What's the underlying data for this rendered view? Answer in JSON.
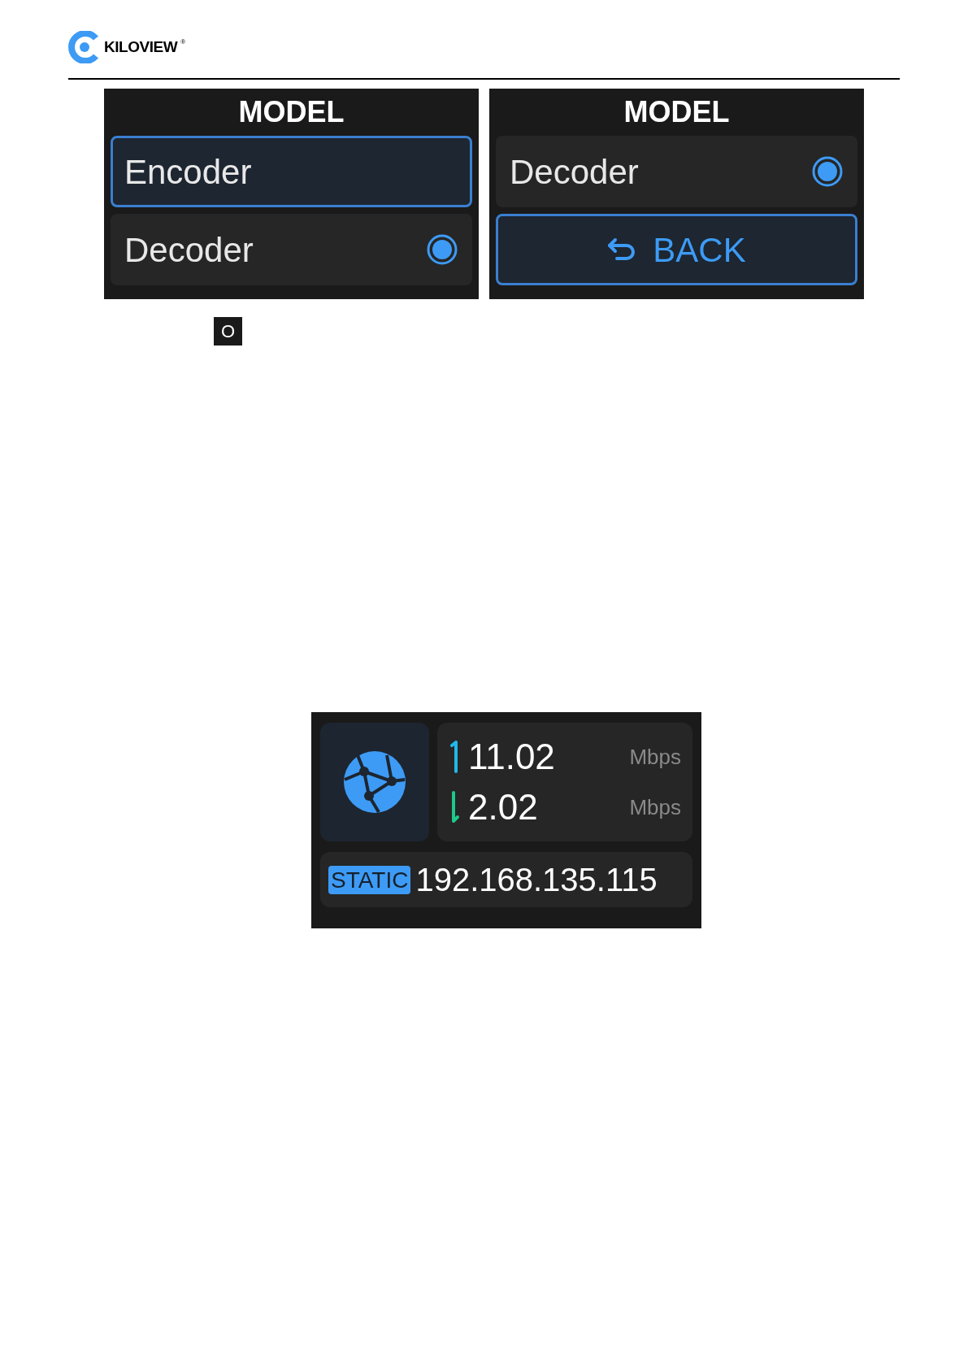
{
  "header": {
    "logo": "KILOVIEW",
    "registered": "®"
  },
  "screens": [
    {
      "title": "MODEL",
      "items": [
        {
          "kind": "option",
          "label": "Encoder",
          "selected": true,
          "checked": false
        },
        {
          "kind": "option",
          "label": "Decoder",
          "selected": false,
          "checked": true
        }
      ]
    },
    {
      "title": "MODEL",
      "items": [
        {
          "kind": "option",
          "label": "Decoder",
          "selected": false,
          "checked": true
        },
        {
          "kind": "back",
          "label": "BACK",
          "selected": true
        }
      ]
    }
  ],
  "key_hint": {
    "label": "O"
  },
  "network": {
    "rates": [
      {
        "kind": "up",
        "value": "11.02",
        "unit": "Mbps"
      },
      {
        "kind": "down",
        "value": "2.02",
        "unit": "Mbps"
      }
    ],
    "ip_mode": "STATIC",
    "ip": "192.168.135.115"
  }
}
